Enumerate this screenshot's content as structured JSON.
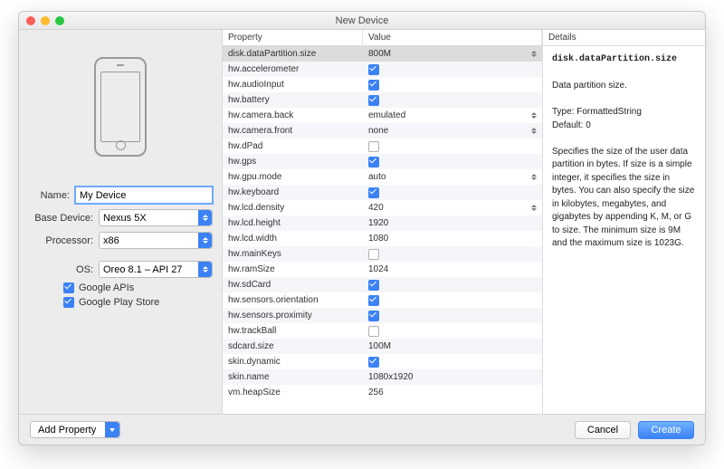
{
  "title": "New Device",
  "sidebar": {
    "name_label": "Name:",
    "name_value": "My Device",
    "base_label": "Base Device:",
    "base_value": "Nexus 5X",
    "proc_label": "Processor:",
    "proc_value": "x86",
    "os_label": "OS:",
    "os_value": "Oreo 8.1 – API 27",
    "google_apis": "Google APIs",
    "google_play": "Google Play Store"
  },
  "columns": {
    "property": "Property",
    "value": "Value",
    "details": "Details"
  },
  "properties": [
    {
      "name": "disk.dataPartition.size",
      "type": "text",
      "value": "800M",
      "selected": true,
      "stepper": true
    },
    {
      "name": "hw.accelerometer",
      "type": "check",
      "checked": true
    },
    {
      "name": "hw.audioInput",
      "type": "check",
      "checked": true
    },
    {
      "name": "hw.battery",
      "type": "check",
      "checked": true
    },
    {
      "name": "hw.camera.back",
      "type": "text",
      "value": "emulated",
      "stepper": true
    },
    {
      "name": "hw.camera.front",
      "type": "text",
      "value": "none",
      "stepper": true
    },
    {
      "name": "hw.dPad",
      "type": "check",
      "checked": false
    },
    {
      "name": "hw.gps",
      "type": "check",
      "checked": true
    },
    {
      "name": "hw.gpu.mode",
      "type": "text",
      "value": "auto",
      "stepper": true
    },
    {
      "name": "hw.keyboard",
      "type": "check",
      "checked": true
    },
    {
      "name": "hw.lcd.density",
      "type": "text",
      "value": "420",
      "stepper": true
    },
    {
      "name": "hw.lcd.height",
      "type": "text",
      "value": "1920"
    },
    {
      "name": "hw.lcd.width",
      "type": "text",
      "value": "1080"
    },
    {
      "name": "hw.mainKeys",
      "type": "check",
      "checked": false
    },
    {
      "name": "hw.ramSize",
      "type": "text",
      "value": "1024"
    },
    {
      "name": "hw.sdCard",
      "type": "check",
      "checked": true
    },
    {
      "name": "hw.sensors.orientation",
      "type": "check",
      "checked": true
    },
    {
      "name": "hw.sensors.proximity",
      "type": "check",
      "checked": true
    },
    {
      "name": "hw.trackBall",
      "type": "check",
      "checked": false
    },
    {
      "name": "sdcard.size",
      "type": "text",
      "value": "100M"
    },
    {
      "name": "skin.dynamic",
      "type": "check",
      "checked": true
    },
    {
      "name": "skin.name",
      "type": "text",
      "value": "1080x1920"
    },
    {
      "name": "vm.heapSize",
      "type": "text",
      "value": "256"
    }
  ],
  "details": {
    "title": "disk.dataPartition.size",
    "subtitle": "Data partition size.",
    "type_line": "Type: FormattedString",
    "default_line": "Default: 0",
    "desc": "Specifies the size of the user data partition in bytes. If size is a simple integer, it specifies the size in bytes. You can also specify the size in kilobytes, megabytes, and gigabytes by appending K, M, or G to size. The minimum size is 9M and the maximum size is 1023G."
  },
  "footer": {
    "add_property": "Add Property",
    "cancel": "Cancel",
    "create": "Create"
  }
}
